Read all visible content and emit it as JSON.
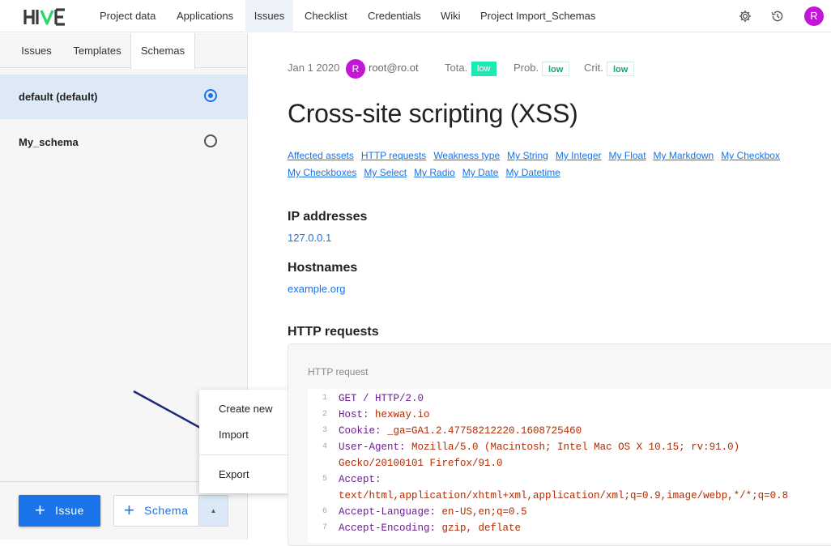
{
  "app": {
    "logo_text": "HIVE"
  },
  "nav": {
    "items": [
      {
        "label": "Project data"
      },
      {
        "label": "Applications"
      },
      {
        "label": "Issues"
      },
      {
        "label": "Checklist"
      },
      {
        "label": "Credentials"
      },
      {
        "label": "Wiki"
      },
      {
        "label": "Project Import_Schemas"
      }
    ],
    "active": "Issues",
    "user_initial": "R"
  },
  "sidebar": {
    "tabs": [
      {
        "label": "Issues"
      },
      {
        "label": "Templates"
      },
      {
        "label": "Schemas"
      }
    ],
    "active_tab": "Schemas",
    "schemas": [
      {
        "label": "default (default)",
        "selected": true
      },
      {
        "label": "My_schema",
        "selected": false
      }
    ],
    "buttons": {
      "issue_label": "Issue",
      "schema_label": "Schema"
    }
  },
  "menu": {
    "items": [
      {
        "label": "Create new"
      },
      {
        "label": "Import"
      },
      {
        "label": "Export"
      }
    ]
  },
  "issue": {
    "date": "Jan 1 2020",
    "author_initial": "R",
    "author": "root@ro.ot",
    "ratings": [
      {
        "label": "Tota.",
        "value": "low",
        "style": "solid"
      },
      {
        "label": "Prob.",
        "value": "low",
        "style": "outline"
      },
      {
        "label": "Crit.",
        "value": "low",
        "style": "outline"
      }
    ],
    "title": "Cross-site scripting (XSS)",
    "field_links": [
      "Affected assets",
      "HTTP requests",
      "Weakness type",
      "My String",
      "My Integer",
      "My Float",
      "My Markdown",
      "My Checkbox",
      "My Checkboxes",
      "My Select",
      "My Radio",
      "My Date",
      "My Datetime"
    ],
    "ip_heading": "IP addresses",
    "ip_value": "127.0.0.1",
    "host_heading": "Hostnames",
    "host_value": "example.org",
    "http_heading": "HTTP requests",
    "http_label": "HTTP request",
    "code_lines": [
      {
        "n": "1",
        "key": "GET",
        "sep": " / ",
        "val": "HTTP/2.0"
      },
      {
        "n": "2",
        "key": "Host:",
        "sep": " ",
        "val": "hexway.io"
      },
      {
        "n": "3",
        "key": "Cookie:",
        "sep": " ",
        "val": "_ga=GA1.2.47758212220.1608725460"
      },
      {
        "n": "4",
        "key": "User-Agent:",
        "sep": " ",
        "val": "Mozilla/5.0 (Macintosh; Intel Mac OS X 10.15; rv:91.0)"
      },
      {
        "n": "",
        "key": "",
        "sep": "",
        "val": "Gecko/20100101 Firefox/91.0"
      },
      {
        "n": "5",
        "key": "Accept:",
        "sep": "",
        "val": ""
      },
      {
        "n": "",
        "key": "",
        "sep": "",
        "val": "text/html,application/xhtml+xml,application/xml;q=0.9,image/webp,*/*;q=0.8"
      },
      {
        "n": "6",
        "key": "Accept-Language:",
        "sep": " ",
        "val": "en-US,en;q=0.5"
      },
      {
        "n": "7",
        "key": "Accept-Encoding:",
        "sep": " ",
        "val": "gzip, deflate"
      }
    ]
  },
  "colors": {
    "accent": "#1a73e8",
    "avatar": "#c316d6",
    "badge": "#1de9b6",
    "selected_row": "#dde9f6"
  }
}
